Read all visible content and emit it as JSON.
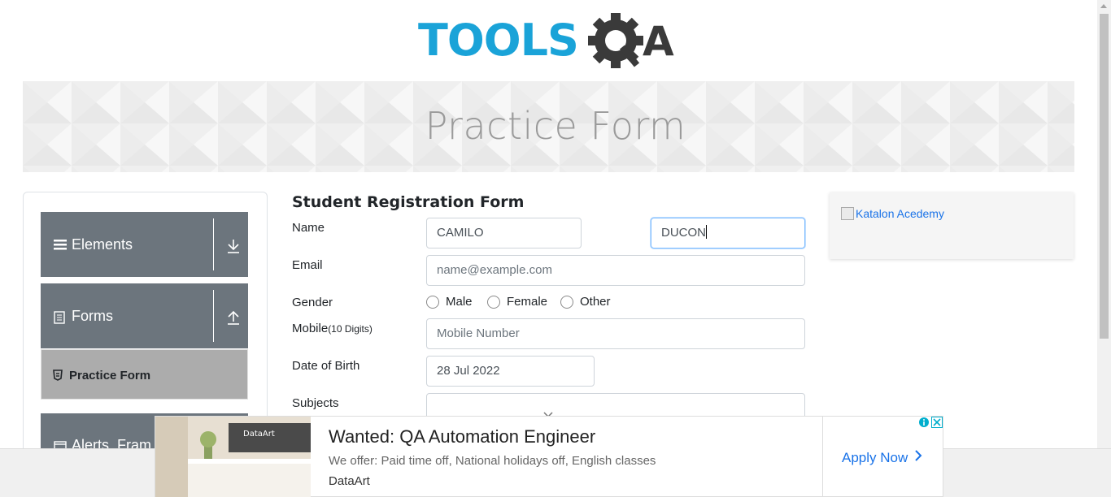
{
  "header": {
    "logo_primary": "TOOLS",
    "logo_secondary": "QA"
  },
  "banner": {
    "title": "Practice Form"
  },
  "sidebar": {
    "groups": [
      {
        "label": "Elements",
        "icon": "list-icon",
        "arrow": "download-arrow-icon"
      },
      {
        "label": "Forms",
        "icon": "document-icon",
        "arrow": "upload-arrow-icon"
      },
      {
        "label": "Alerts, Fram",
        "icon": "window-icon"
      }
    ],
    "active_item": {
      "label": "Practice Form",
      "icon": "shield-icon"
    }
  },
  "form": {
    "title": "Student Registration Form",
    "name_label": "Name",
    "first_name": "CAMILO",
    "last_name": "DUCON",
    "email_label": "Email",
    "email_placeholder": "name@example.com",
    "gender_label": "Gender",
    "gender_options": [
      "Male",
      "Female",
      "Other"
    ],
    "mobile_label": "Mobile",
    "mobile_hint": "(10 Digits)",
    "mobile_placeholder": "Mobile Number",
    "dob_label": "Date of Birth",
    "dob_value": "28 Jul 2022",
    "subjects_label": "Subjects"
  },
  "side_ad": {
    "alt_text": "Katalon Acedemy"
  },
  "bottom_ad": {
    "headline": "Wanted: QA Automation Engineer",
    "description": "We offer: Paid time off, National holidays off, English classes",
    "brand": "DataArt",
    "cta": "Apply Now",
    "photo_sign": "DataArt"
  },
  "colors": {
    "logo_blue": "#1aa3d8",
    "logo_dark": "#3a3a3a",
    "menu_gray": "#6c757d",
    "active_gray": "#acacac",
    "link_blue": "#1a73e8"
  }
}
